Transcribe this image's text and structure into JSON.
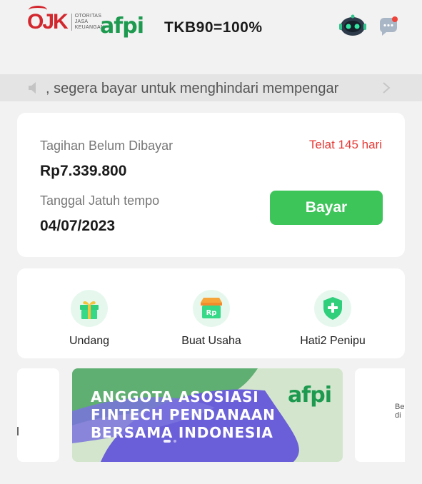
{
  "header": {
    "ojk_logo_text": "OJK",
    "ojk_subtitle": [
      "OTORITAS",
      "JASA",
      "KEUANGAN"
    ],
    "afpi_logo_text": "afpi",
    "tkb": "TKB90=100%"
  },
  "notice": {
    "text": ", segera bayar untuk menghindari mempengar"
  },
  "bill": {
    "label": "Tagihan Belum Dibayar",
    "overdue": "Telat 145 hari",
    "amount": "Rp7.339.800",
    "due_label": "Tanggal Jatuh tempo",
    "due_date": "04/07/2023",
    "pay_button": "Bayar"
  },
  "actions": [
    {
      "label": "Undang",
      "icon": "gift-icon"
    },
    {
      "label": "Buat Usaha",
      "icon": "shop-rp-icon"
    },
    {
      "label": "Hati2 Penipu",
      "icon": "shield-plus-icon"
    }
  ],
  "banner": {
    "lines": [
      "ANGGOTA ASOSIASI",
      "FINTECH PENDANAAN",
      "BERSAMA INDONESIA"
    ],
    "logo": "afpi",
    "right_fragment": [
      "Be",
      "di"
    ]
  },
  "colors": {
    "accent_green": "#3dc55a",
    "brand_green": "#1d9a4f",
    "overdue_red": "#e53935",
    "ojk_red": "#d3272e",
    "banner_purple": "#6a5fd8"
  }
}
